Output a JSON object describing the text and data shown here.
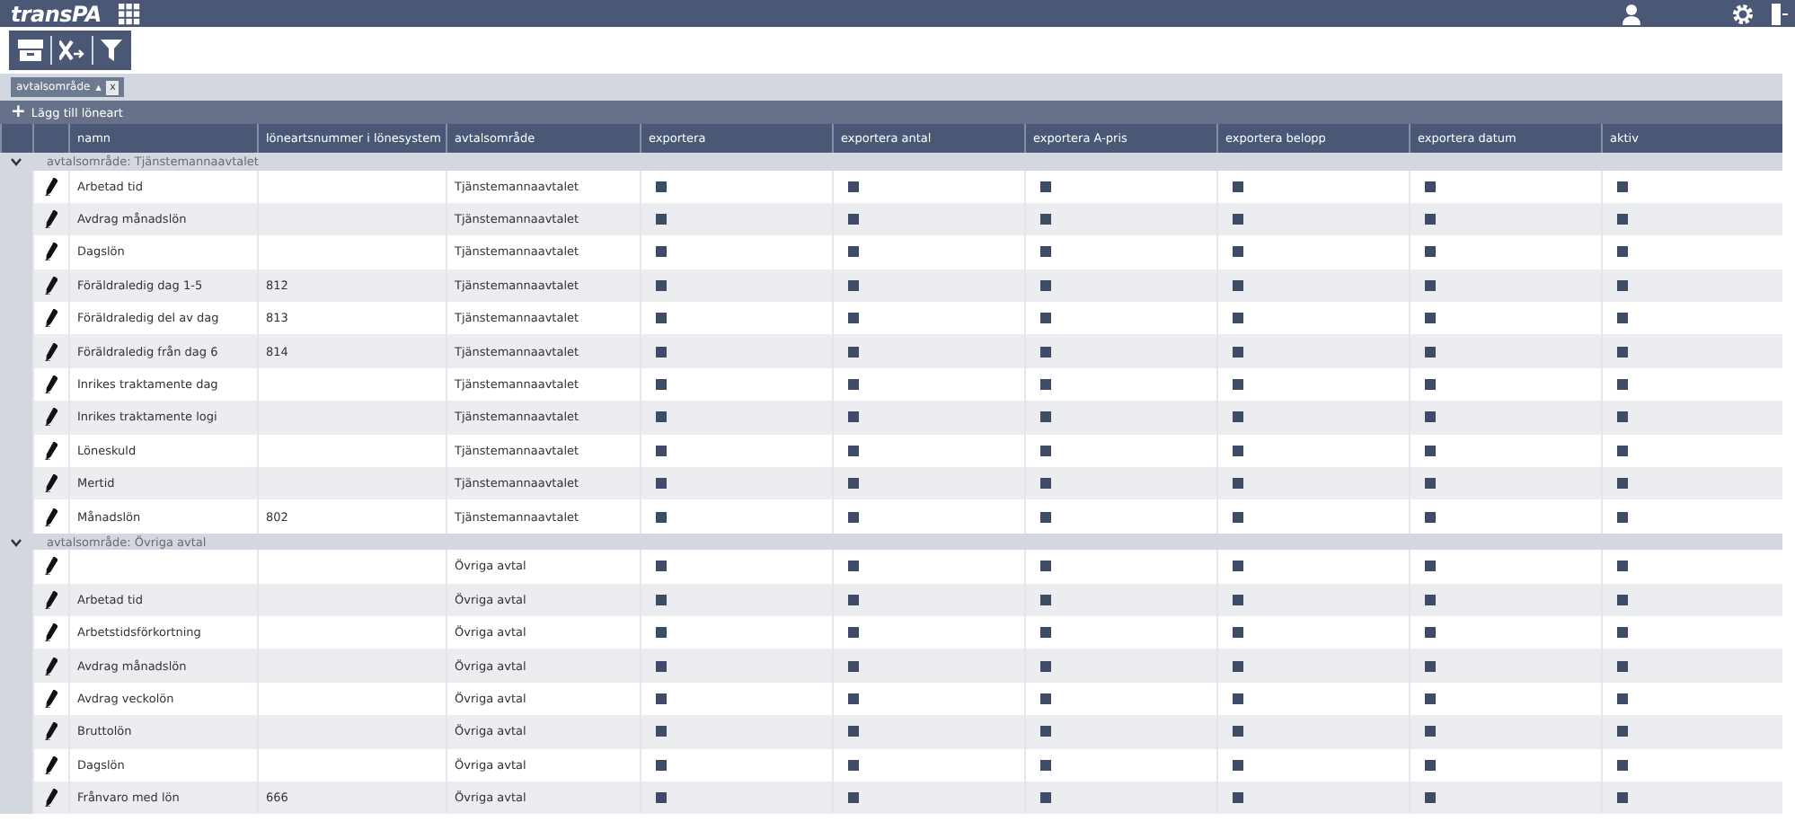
{
  "app": {
    "logo": "transPA"
  },
  "filter_chips": [
    {
      "label": "avtalsområde",
      "sort_arrow": "▲",
      "remove": "x"
    }
  ],
  "add_button": {
    "icon": "+",
    "label": "Lägg till löneart"
  },
  "table": {
    "columns": [
      "namn",
      "löneartsnummer i lönesystem",
      "avtalsområde",
      "exportera",
      "exportera antal",
      "exportera A-pris",
      "exportera belopp",
      "exportera datum",
      "aktiv"
    ],
    "groups": [
      {
        "label": "avtalsområde: Tjänstemannaavtalet",
        "expanded": true,
        "rows": [
          {
            "namn": "Arbetad tid",
            "nummer": "",
            "avtal": "Tjänstemannaavtalet",
            "checks": [
              true,
              true,
              true,
              true,
              true,
              true
            ]
          },
          {
            "namn": "Avdrag månadslön",
            "nummer": "",
            "avtal": "Tjänstemannaavtalet",
            "checks": [
              true,
              true,
              true,
              true,
              true,
              true
            ]
          },
          {
            "namn": "Dagslön",
            "nummer": "",
            "avtal": "Tjänstemannaavtalet",
            "checks": [
              true,
              true,
              true,
              true,
              true,
              true
            ]
          },
          {
            "namn": "Föräldraledig dag 1-5",
            "nummer": "812",
            "avtal": "Tjänstemannaavtalet",
            "checks": [
              true,
              true,
              true,
              true,
              true,
              true
            ]
          },
          {
            "namn": "Föräldraledig del av dag",
            "nummer": "813",
            "avtal": "Tjänstemannaavtalet",
            "checks": [
              true,
              true,
              true,
              true,
              true,
              true
            ]
          },
          {
            "namn": "Föräldraledig från dag 6",
            "nummer": "814",
            "avtal": "Tjänstemannaavtalet",
            "checks": [
              true,
              true,
              true,
              true,
              true,
              true
            ]
          },
          {
            "namn": "Inrikes traktamente dag",
            "nummer": "",
            "avtal": "Tjänstemannaavtalet",
            "checks": [
              true,
              true,
              true,
              true,
              true,
              true
            ]
          },
          {
            "namn": "Inrikes traktamente logi",
            "nummer": "",
            "avtal": "Tjänstemannaavtalet",
            "checks": [
              true,
              true,
              true,
              true,
              true,
              true
            ]
          },
          {
            "namn": "Löneskuld",
            "nummer": "",
            "avtal": "Tjänstemannaavtalet",
            "checks": [
              true,
              true,
              true,
              true,
              true,
              true
            ]
          },
          {
            "namn": "Mertid",
            "nummer": "",
            "avtal": "Tjänstemannaavtalet",
            "checks": [
              true,
              true,
              true,
              true,
              true,
              true
            ]
          },
          {
            "namn": "Månadslön",
            "nummer": "802",
            "avtal": "Tjänstemannaavtalet",
            "checks": [
              true,
              true,
              true,
              true,
              true,
              true
            ]
          }
        ]
      },
      {
        "label": "avtalsområde: Övriga avtal",
        "expanded": true,
        "rows": [
          {
            "namn": "",
            "nummer": "",
            "avtal": "Övriga avtal",
            "checks": [
              true,
              true,
              true,
              true,
              true,
              true
            ]
          },
          {
            "namn": "Arbetad tid",
            "nummer": "",
            "avtal": "Övriga avtal",
            "checks": [
              true,
              true,
              true,
              true,
              true,
              true
            ]
          },
          {
            "namn": "Arbetstidsförkortning",
            "nummer": "",
            "avtal": "Övriga avtal",
            "checks": [
              true,
              true,
              true,
              true,
              true,
              true
            ]
          },
          {
            "namn": "Avdrag månadslön",
            "nummer": "",
            "avtal": "Övriga avtal",
            "checks": [
              true,
              true,
              true,
              true,
              true,
              true
            ]
          },
          {
            "namn": "Avdrag veckolön",
            "nummer": "",
            "avtal": "Övriga avtal",
            "checks": [
              true,
              true,
              true,
              true,
              true,
              true
            ]
          },
          {
            "namn": "Bruttolön",
            "nummer": "",
            "avtal": "Övriga avtal",
            "checks": [
              true,
              true,
              true,
              true,
              true,
              true
            ]
          },
          {
            "namn": "Dagslön",
            "nummer": "",
            "avtal": "Övriga avtal",
            "checks": [
              true,
              true,
              true,
              true,
              true,
              true
            ]
          },
          {
            "namn": "Frånvaro med lön",
            "nummer": "666",
            "avtal": "Övriga avtal",
            "checks": [
              true,
              true,
              true,
              true,
              true,
              true
            ]
          }
        ]
      }
    ]
  }
}
